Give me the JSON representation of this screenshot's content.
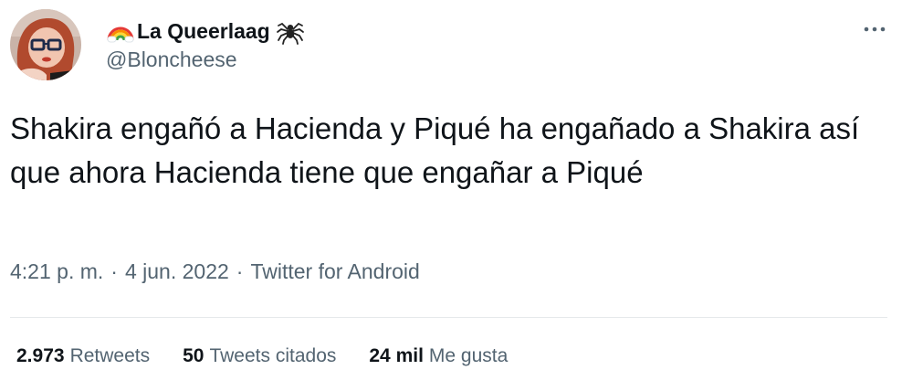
{
  "author": {
    "display_name": "La Queerlaag",
    "handle": "@Bloncheese",
    "name_prefix_icon": "rainbow-icon",
    "name_suffix_icon": "spider-icon"
  },
  "tweet": {
    "text": "Shakira engañó a Hacienda y Piqué ha engañado a Shakira así que ahora Hacienda tiene que engañar a Piqué",
    "time": "4:21 p. m.",
    "date": "4 jun. 2022",
    "source": "Twitter for Android",
    "separator": "·"
  },
  "stats": [
    {
      "count": "2.973",
      "label": "Retweets"
    },
    {
      "count": "50",
      "label": "Tweets citados"
    },
    {
      "count": "24 mil",
      "label": "Me gusta"
    }
  ],
  "colors": {
    "primary_text": "#0f1419",
    "secondary_text": "#536471",
    "divider": "#e6e9eb"
  }
}
